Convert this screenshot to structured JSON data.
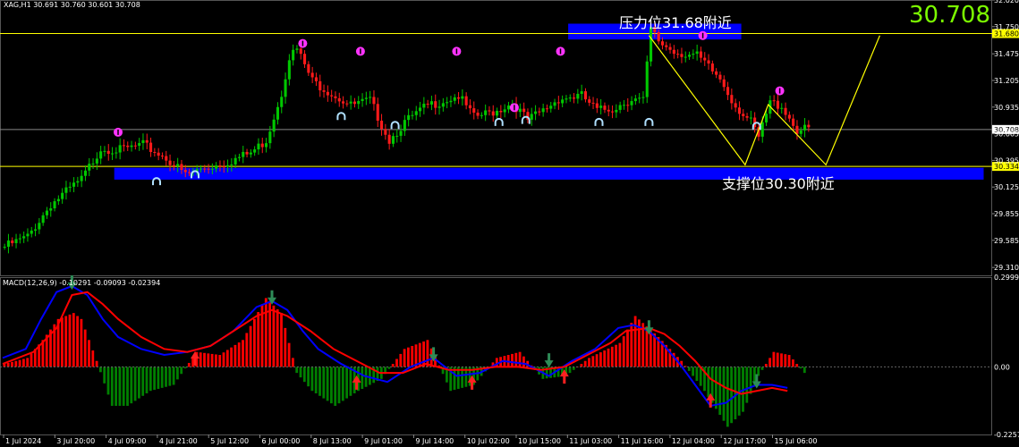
{
  "header": {
    "symbol_info": "XAG,H1  30.691 30.760 30.601 30.708",
    "last_price": "30.708",
    "macd_label": "MACD(12,26,9) -0.10291 -0.09093 -0.02394"
  },
  "annotations": {
    "resistance": "压力位31.68附近",
    "support": "支撑位30.30附近"
  },
  "colors": {
    "background": "#000000",
    "bull": "#00c800",
    "bear": "#ff1a1a",
    "level_line": "#ffff00",
    "zone": "#0000ff",
    "macd_line": "#0000ff",
    "signal_line": "#ff0000",
    "hist_up": "#ff0000",
    "hist_down": "#008000",
    "fractal_up": "#ff33ff",
    "fractal_down": "#b0e0ff",
    "price_text": "#7cfc00"
  },
  "chart_data": {
    "type": "candlestick",
    "symbol": "XAG",
    "timeframe": "H1",
    "ylim": [
      29.23,
      32.02
    ],
    "y_ticks": [
      "32.020",
      "31.750",
      "31.475",
      "31.205",
      "30.935",
      "30.665",
      "30.395",
      "30.125",
      "29.855",
      "29.585",
      "29.310"
    ],
    "x_ticks": [
      "1 Jul 2024",
      "3 Jul 20:00",
      "4 Jul 09:00",
      "4 Jul 21:00",
      "5 Jul 12:00",
      "6 Jul 00:00",
      "8 Jul 13:00",
      "9 Jul 01:00",
      "9 Jul 14:00",
      "10 Jul 02:00",
      "10 Jul 15:00",
      "11 Jul 03:00",
      "11 Jul 16:00",
      "12 Jul 04:00",
      "12 Jul 17:00",
      "15 Jul 06:00"
    ],
    "price_path": [
      [
        0,
        29.52
      ],
      [
        6,
        29.62
      ],
      [
        12,
        29.95
      ],
      [
        20,
        30.2
      ],
      [
        25,
        30.52
      ],
      [
        30,
        30.5
      ],
      [
        36,
        30.55
      ],
      [
        42,
        30.42
      ],
      [
        47,
        30.25
      ],
      [
        52,
        30.32
      ],
      [
        58,
        30.38
      ],
      [
        64,
        30.47
      ],
      [
        68,
        30.6
      ],
      [
        72,
        31.08
      ],
      [
        74,
        31.45
      ],
      [
        76,
        31.52
      ],
      [
        80,
        31.2
      ],
      [
        86,
        31.05
      ],
      [
        90,
        30.95
      ],
      [
        95,
        31.0
      ],
      [
        100,
        30.6
      ],
      [
        104,
        30.78
      ],
      [
        110,
        30.95
      ],
      [
        118,
        31.05
      ],
      [
        122,
        30.83
      ],
      [
        128,
        30.9
      ],
      [
        132,
        30.98
      ],
      [
        136,
        30.8
      ],
      [
        140,
        30.9
      ],
      [
        144,
        31.02
      ],
      [
        150,
        31.05
      ],
      [
        154,
        30.9
      ],
      [
        158,
        30.92
      ],
      [
        163,
        31.02
      ],
      [
        166,
        31.0
      ],
      [
        168,
        31.72
      ],
      [
        170,
        31.6
      ],
      [
        174,
        31.5
      ],
      [
        180,
        31.45
      ],
      [
        186,
        31.22
      ],
      [
        190,
        30.95
      ],
      [
        194,
        30.78
      ],
      [
        196,
        30.62
      ],
      [
        199,
        30.98
      ],
      [
        202,
        30.95
      ],
      [
        206,
        30.7
      ],
      [
        209,
        30.71
      ]
    ],
    "price_levels": [
      {
        "name": "resistance",
        "price": 31.68,
        "label": "31.680"
      },
      {
        "name": "support",
        "price": 30.334,
        "label": "30.334"
      },
      {
        "name": "current",
        "price": 30.708,
        "label": "30.708"
      }
    ],
    "zones": [
      {
        "name": "resistance-zone",
        "bar_from": 147,
        "bar_to": 192,
        "y_from": 31.62,
        "y_to": 31.78
      },
      {
        "name": "support-zone",
        "bar_from": 29,
        "bar_to": 255,
        "y_from": 30.2,
        "y_to": 30.32
      }
    ],
    "projection_path": [
      [
        168,
        31.66
      ],
      [
        193,
        30.35
      ],
      [
        199,
        30.96
      ],
      [
        214,
        30.35
      ],
      [
        228,
        31.66
      ]
    ],
    "fractals_up": [
      [
        30,
        30.68
      ],
      [
        78,
        31.58
      ],
      [
        93,
        31.5
      ],
      [
        118,
        31.5
      ],
      [
        145,
        31.5
      ],
      [
        182,
        31.66
      ],
      [
        202,
        31.1
      ],
      [
        133,
        30.93
      ]
    ],
    "fractals_down": [
      [
        40,
        30.18
      ],
      [
        50,
        30.25
      ],
      [
        88,
        30.84
      ],
      [
        102,
        30.75
      ],
      [
        129,
        30.78
      ],
      [
        136,
        30.8
      ],
      [
        155,
        30.78
      ],
      [
        168,
        30.78
      ],
      [
        196,
        30.74
      ]
    ],
    "macd": {
      "ylim": [
        -0.2257,
        0.2999
      ],
      "y_ticks": [
        "0.29994",
        "0.00",
        "-0.2257"
      ],
      "histogram": [
        [
          0,
          0.01
        ],
        [
          6,
          0.03
        ],
        [
          10,
          0.09
        ],
        [
          14,
          0.16
        ],
        [
          18,
          0.18
        ],
        [
          20,
          0.16
        ],
        [
          24,
          0.02
        ],
        [
          28,
          -0.13
        ],
        [
          32,
          -0.13
        ],
        [
          38,
          -0.08
        ],
        [
          44,
          -0.06
        ],
        [
          50,
          0.05
        ],
        [
          56,
          0.04
        ],
        [
          62,
          0.09
        ],
        [
          68,
          0.23
        ],
        [
          72,
          0.18
        ],
        [
          76,
          -0.02
        ],
        [
          80,
          -0.08
        ],
        [
          86,
          -0.13
        ],
        [
          92,
          -0.08
        ],
        [
          98,
          -0.04
        ],
        [
          104,
          0.06
        ],
        [
          110,
          0.09
        ],
        [
          116,
          -0.08
        ],
        [
          122,
          -0.06
        ],
        [
          128,
          0.03
        ],
        [
          134,
          0.05
        ],
        [
          140,
          -0.04
        ],
        [
          146,
          -0.03
        ],
        [
          152,
          0.03
        ],
        [
          160,
          0.08
        ],
        [
          164,
          0.17
        ],
        [
          170,
          0.1
        ],
        [
          176,
          0.02
        ],
        [
          182,
          -0.08
        ],
        [
          188,
          -0.2
        ],
        [
          192,
          -0.15
        ],
        [
          196,
          -0.03
        ],
        [
          200,
          0.05
        ],
        [
          204,
          0.04
        ],
        [
          208,
          -0.02
        ]
      ],
      "macd_line": [
        [
          0,
          0.03
        ],
        [
          6,
          0.06
        ],
        [
          10,
          0.16
        ],
        [
          14,
          0.25
        ],
        [
          18,
          0.27
        ],
        [
          22,
          0.24
        ],
        [
          26,
          0.16
        ],
        [
          30,
          0.1
        ],
        [
          36,
          0.06
        ],
        [
          42,
          0.04
        ],
        [
          48,
          0.05
        ],
        [
          54,
          0.07
        ],
        [
          60,
          0.12
        ],
        [
          66,
          0.2
        ],
        [
          70,
          0.22
        ],
        [
          74,
          0.19
        ],
        [
          78,
          0.12
        ],
        [
          82,
          0.06
        ],
        [
          88,
          0.01
        ],
        [
          94,
          -0.03
        ],
        [
          100,
          -0.05
        ],
        [
          106,
          0.0
        ],
        [
          112,
          0.03
        ],
        [
          118,
          -0.03
        ],
        [
          124,
          -0.02
        ],
        [
          130,
          0.02
        ],
        [
          136,
          0.01
        ],
        [
          142,
          -0.03
        ],
        [
          148,
          0.02
        ],
        [
          154,
          0.06
        ],
        [
          160,
          0.13
        ],
        [
          164,
          0.14
        ],
        [
          168,
          0.12
        ],
        [
          172,
          0.07
        ],
        [
          176,
          0.01
        ],
        [
          180,
          -0.06
        ],
        [
          184,
          -0.13
        ],
        [
          188,
          -0.12
        ],
        [
          192,
          -0.08
        ],
        [
          196,
          -0.06
        ],
        [
          200,
          -0.06
        ],
        [
          204,
          -0.07
        ]
      ],
      "signal_line": [
        [
          0,
          0.01
        ],
        [
          8,
          0.05
        ],
        [
          14,
          0.13
        ],
        [
          18,
          0.24
        ],
        [
          22,
          0.25
        ],
        [
          26,
          0.21
        ],
        [
          30,
          0.16
        ],
        [
          36,
          0.1
        ],
        [
          42,
          0.06
        ],
        [
          48,
          0.05
        ],
        [
          54,
          0.07
        ],
        [
          60,
          0.12
        ],
        [
          66,
          0.17
        ],
        [
          70,
          0.19
        ],
        [
          74,
          0.17
        ],
        [
          80,
          0.12
        ],
        [
          86,
          0.06
        ],
        [
          92,
          0.02
        ],
        [
          98,
          -0.02
        ],
        [
          104,
          -0.02
        ],
        [
          110,
          0.01
        ],
        [
          116,
          -0.01
        ],
        [
          122,
          -0.01
        ],
        [
          128,
          0.0
        ],
        [
          134,
          0.0
        ],
        [
          140,
          -0.01
        ],
        [
          146,
          0.0
        ],
        [
          152,
          0.04
        ],
        [
          158,
          0.08
        ],
        [
          162,
          0.12
        ],
        [
          168,
          0.13
        ],
        [
          172,
          0.11
        ],
        [
          176,
          0.07
        ],
        [
          180,
          0.02
        ],
        [
          184,
          -0.04
        ],
        [
          188,
          -0.07
        ],
        [
          192,
          -0.09
        ],
        [
          196,
          -0.08
        ],
        [
          200,
          -0.07
        ],
        [
          204,
          -0.08
        ]
      ],
      "arrows_down": [
        [
          18,
          0.27
        ],
        [
          70,
          0.22
        ],
        [
          112,
          0.03
        ],
        [
          142,
          0.01
        ],
        [
          168,
          0.12
        ],
        [
          196,
          -0.06
        ]
      ],
      "arrows_up": [
        [
          50,
          0.04
        ],
        [
          92,
          -0.04
        ],
        [
          122,
          -0.04
        ],
        [
          146,
          -0.02
        ],
        [
          184,
          -0.1
        ]
      ]
    }
  }
}
